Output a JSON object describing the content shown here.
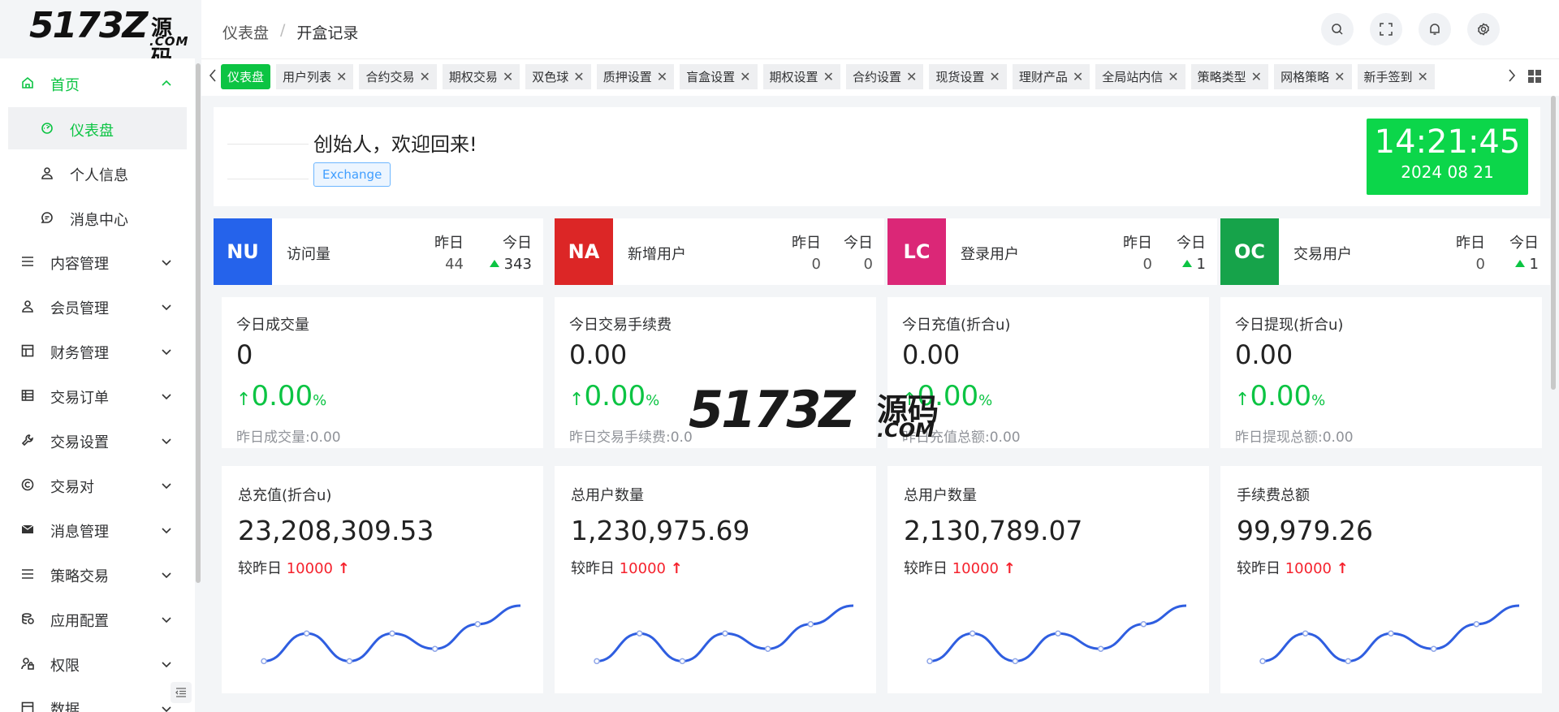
{
  "logo": {
    "brand": "5173Z",
    "cn": "源码",
    "com": ".COM"
  },
  "breadcrumb": [
    "仪表盘",
    "/",
    "开盒记录"
  ],
  "sidebar": {
    "items": [
      {
        "label": "首页",
        "icon": "home-icon",
        "expanded": true
      },
      {
        "label": "内容管理",
        "icon": "list-icon"
      },
      {
        "label": "会员管理",
        "icon": "user-icon"
      },
      {
        "label": "财务管理",
        "icon": "finance-icon"
      },
      {
        "label": "交易订单",
        "icon": "table-icon"
      },
      {
        "label": "交易设置",
        "icon": "wrench-icon"
      },
      {
        "label": "交易对",
        "icon": "copyright-icon"
      },
      {
        "label": "消息管理",
        "icon": "mail-icon"
      },
      {
        "label": "策略交易",
        "icon": "list-icon"
      },
      {
        "label": "应用配置",
        "icon": "coin-icon"
      },
      {
        "label": "权限",
        "icon": "user-lock-icon"
      },
      {
        "label": "数据",
        "icon": "data-icon"
      }
    ],
    "sub_items": [
      {
        "label": "仪表盘",
        "icon": "dashboard-icon",
        "active": true
      },
      {
        "label": "个人信息",
        "icon": "person-icon"
      },
      {
        "label": "消息中心",
        "icon": "chat-icon"
      }
    ]
  },
  "tabs": [
    "仪表盘",
    "用户列表",
    "合约交易",
    "期权交易",
    "双色球",
    "质押设置",
    "盲盒设置",
    "期权设置",
    "合约设置",
    "现货设置",
    "理财产品",
    "全局站内信",
    "策略类型",
    "网格策略",
    "新手签到"
  ],
  "welcome": {
    "title": "创始人，欢迎回来!",
    "tag": "Exchange"
  },
  "clock": {
    "time": "14:21:45",
    "date": "2024 08 21"
  },
  "stats": [
    {
      "badge": "NU",
      "color": "#2563eb",
      "label": "访问量",
      "yesterday_label": "昨日",
      "today_label": "今日",
      "yesterday": "44",
      "today": "343"
    },
    {
      "badge": "NA",
      "color": "#dc2626",
      "label": "新增用户",
      "yesterday_label": "昨日",
      "today_label": "今日",
      "yesterday": "0",
      "today": "0"
    },
    {
      "badge": "LC",
      "color": "#db2777",
      "label": "登录用户",
      "yesterday_label": "昨日",
      "today_label": "今日",
      "yesterday": "0",
      "today": "1"
    },
    {
      "badge": "OC",
      "color": "#16a34a",
      "label": "交易用户",
      "yesterday_label": "昨日",
      "today_label": "今日",
      "yesterday": "0",
      "today": "1"
    }
  ],
  "today_cards": [
    {
      "label": "今日成交量",
      "value": "0",
      "pct": "0.00",
      "unit": "%",
      "foot": "昨日成交量:0.00"
    },
    {
      "label": "今日交易手续费",
      "value": "0.00",
      "pct": "0.00",
      "unit": "%",
      "foot": "昨日交易手续费:0.0"
    },
    {
      "label": "今日充值(折合u)",
      "value": "0.00",
      "pct": "0.00",
      "unit": "%",
      "foot": "昨日充值总额:0.00"
    },
    {
      "label": "今日提现(折合u)",
      "value": "0.00",
      "pct": "0.00",
      "unit": "%",
      "foot": "昨日提现总额:0.00"
    }
  ],
  "total_cards": [
    {
      "label": "总充值(折合u)",
      "value": "23,208,309.53",
      "compare_label": "较昨日",
      "compare": "10000"
    },
    {
      "label": "总用户数量",
      "value": "1,230,975.69",
      "compare_label": "较昨日",
      "compare": "10000"
    },
    {
      "label": "总用户数量",
      "value": "2,130,789.07",
      "compare_label": "较昨日",
      "compare": "10000"
    },
    {
      "label": "手续费总额",
      "value": "99,979.26",
      "compare_label": "较昨日",
      "compare": "10000"
    }
  ],
  "sparkline": [
    0.1,
    0.55,
    0.1,
    0.55,
    0.3,
    0.7,
    1.0
  ],
  "accent": "#0cc443"
}
